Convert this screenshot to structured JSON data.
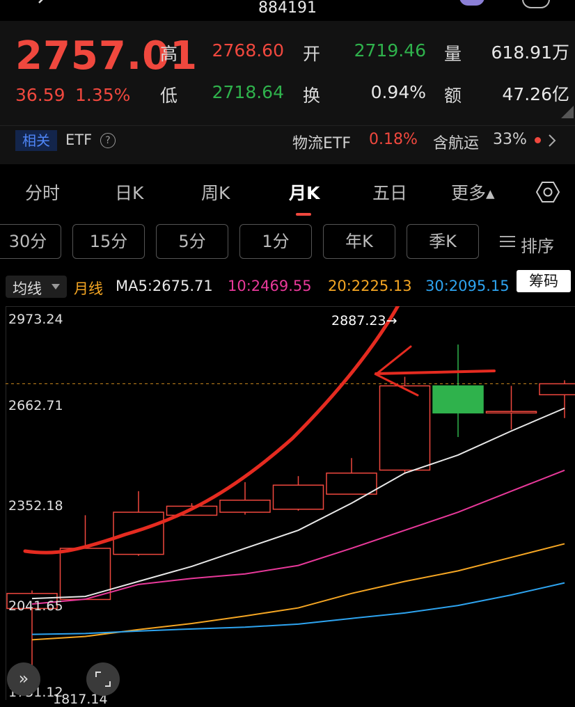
{
  "header": {
    "title": "884191"
  },
  "quote": {
    "price": "2757.01",
    "change": "36.59",
    "change_pct": "1.35%",
    "high_label": "高",
    "high": "2768.60",
    "open_label": "开",
    "open": "2719.46",
    "volume_label": "量",
    "volume": "618.91万",
    "low_label": "低",
    "low": "2718.64",
    "turnover_label": "换",
    "turnover": "0.94%",
    "amount_label": "额",
    "amount": "47.26亿"
  },
  "etf_bar": {
    "tag": "相关",
    "etf": "ETF",
    "help": "?",
    "fund_name": "物流ETF",
    "fund_change": "0.18%",
    "shipping_label": "含航运",
    "shipping_pct": "33%"
  },
  "tabs": [
    {
      "label": "分时"
    },
    {
      "label": "日K"
    },
    {
      "label": "周K"
    },
    {
      "label": "月K"
    },
    {
      "label": "五日"
    },
    {
      "label": "更多▴"
    }
  ],
  "period_buttons": [
    {
      "label": "30分"
    },
    {
      "label": "15分"
    },
    {
      "label": "5分"
    },
    {
      "label": "1分"
    },
    {
      "label": "年K"
    },
    {
      "label": "季K"
    }
  ],
  "sort_label": "排序",
  "ma_bar": {
    "selector": "均线",
    "period": "月线",
    "ma5": "MA5:2675.71",
    "ma10": "10:2469.55",
    "ma20": "20:2225.13",
    "ma30": "30:2095.15",
    "chips": "筹码"
  },
  "colors": {
    "up": "#f0483e",
    "down": "#2fb24c",
    "ma5": "#e8e8e8",
    "ma10": "#e8399a",
    "ma20": "#f5a623",
    "ma30": "#2ea4f0"
  },
  "chart_data": {
    "type": "candlestick",
    "y_ticks": [
      "2973.24",
      "2662.71",
      "2352.18",
      "2041.65",
      "1731.12"
    ],
    "ylim": [
      1731.12,
      2973.24
    ],
    "peak_label": "2887.23→",
    "bottom_label": "1817.14",
    "current_price_line": 2757.01,
    "candles": [
      {
        "open": 2010,
        "close": 2060,
        "high": 2070,
        "low": 1817.14
      },
      {
        "open": 2040,
        "close": 2210,
        "high": 2320,
        "low": 2040
      },
      {
        "open": 2190,
        "close": 2330,
        "high": 2400,
        "low": 2185
      },
      {
        "open": 2320,
        "close": 2350,
        "high": 2360,
        "low": 2320
      },
      {
        "open": 2330,
        "close": 2370,
        "high": 2430,
        "low": 2322
      },
      {
        "open": 2340,
        "close": 2420,
        "high": 2450,
        "low": 2335
      },
      {
        "open": 2390,
        "close": 2460,
        "high": 2510,
        "low": 2390
      },
      {
        "open": 2470,
        "close": 2750,
        "high": 2780,
        "low": 2460
      },
      {
        "open": 2750,
        "close": 2660,
        "high": 2887.23,
        "low": 2580
      },
      {
        "open": 2660,
        "close": 2665,
        "high": 2750,
        "low": 2605
      },
      {
        "open": 2720.5,
        "close": 2757.01,
        "high": 2768.6,
        "low": 2643
      }
    ],
    "series": [
      {
        "name": "MA5",
        "values": [
          2043,
          2050,
          2100,
          2150,
          2210,
          2270,
          2360,
          2460,
          2520,
          2600,
          2675.71
        ]
      },
      {
        "name": "MA10",
        "values": [
          2025,
          2041,
          2090,
          2110,
          2125,
          2153,
          2210,
          2270,
          2330,
          2400,
          2469.55
        ]
      },
      {
        "name": "MA20",
        "values": [
          1906,
          1917,
          1940,
          1960,
          1985,
          2012,
          2060,
          2100,
          2135,
          2180,
          2225.13
        ]
      },
      {
        "name": "MA30",
        "values": [
          1924,
          1927,
          1935,
          1942,
          1948,
          1958,
          1977,
          1995,
          2020,
          2055,
          2095.15
        ]
      }
    ]
  }
}
